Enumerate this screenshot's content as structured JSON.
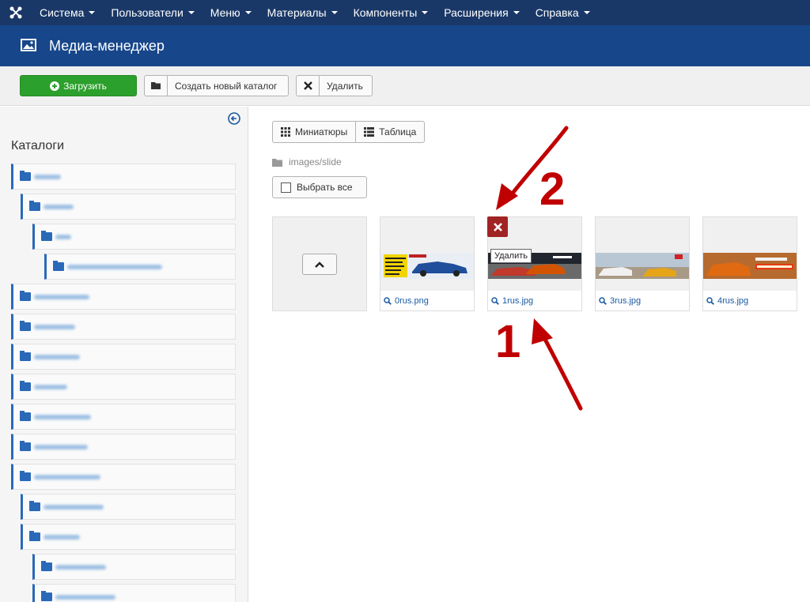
{
  "nav": {
    "items": [
      "Система",
      "Пользователи",
      "Меню",
      "Материалы",
      "Компоненты",
      "Расширения",
      "Справка"
    ]
  },
  "header": {
    "title": "Медиа-менеджер"
  },
  "toolbar": {
    "upload_label": "Загрузить",
    "new_folder_label": "Создать новый каталог",
    "delete_label": "Удалить"
  },
  "sidebar": {
    "heading": "Каталоги"
  },
  "view": {
    "thumbnails_label": "Миниатюры",
    "table_label": "Таблица"
  },
  "path": "images/slide",
  "select_all_label": "Выбрать все",
  "files": [
    {
      "name": "0rus.png"
    },
    {
      "name": "1rus.jpg"
    },
    {
      "name": "3rus.jpg"
    },
    {
      "name": "4rus.jpg"
    }
  ],
  "tooltip": "Удалить",
  "annotations": {
    "first": "1",
    "second": "2"
  },
  "colors": {
    "navbar": "#1a3867",
    "titlebar": "#17478a",
    "upload": "#2ca02c",
    "delete_badge": "#a12424",
    "annotation": "#c00000"
  }
}
